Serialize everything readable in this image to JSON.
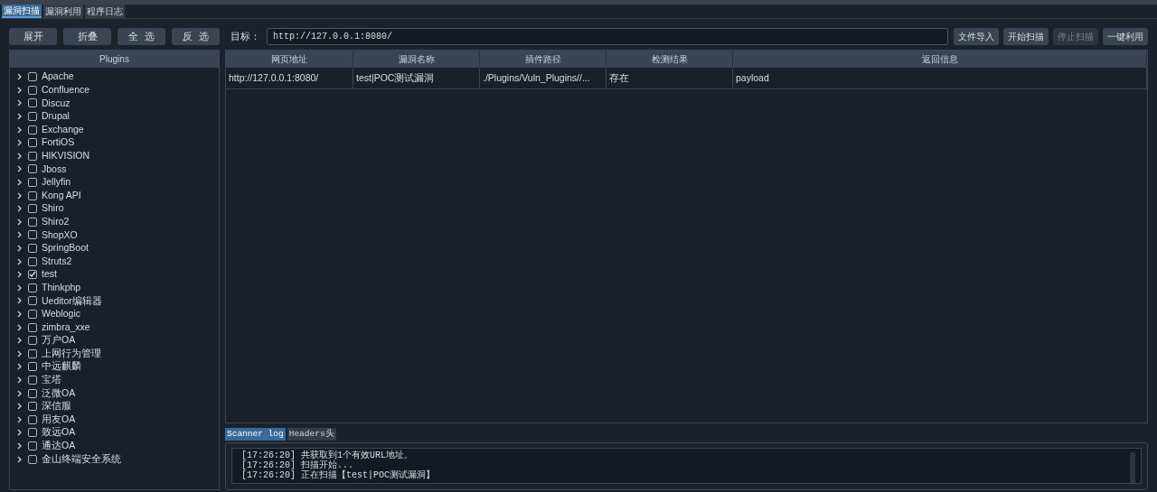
{
  "tabs": [
    {
      "label": "漏洞扫描",
      "selected": true
    },
    {
      "label": "漏洞利用",
      "selected": false
    },
    {
      "label": "程序日志",
      "selected": false
    }
  ],
  "tree_buttons": [
    "展开",
    "折叠",
    "全  选",
    "反  选"
  ],
  "target": {
    "label": "目标：",
    "value": "http://127.0.0.1:8080/"
  },
  "action_buttons": [
    {
      "label": "文件导入",
      "disabled": false
    },
    {
      "label": "开始扫描",
      "disabled": false
    },
    {
      "label": "停止扫描",
      "disabled": true
    },
    {
      "label": "一键利用",
      "disabled": false
    }
  ],
  "plugins": {
    "header": "Plugins",
    "items": [
      {
        "label": "Apache",
        "checked": false
      },
      {
        "label": "Confluence",
        "checked": false
      },
      {
        "label": "Discuz",
        "checked": false
      },
      {
        "label": "Drupal",
        "checked": false
      },
      {
        "label": "Exchange",
        "checked": false
      },
      {
        "label": "FortiOS",
        "checked": false
      },
      {
        "label": "HIKVISION",
        "checked": false
      },
      {
        "label": "Jboss",
        "checked": false
      },
      {
        "label": "Jellyfin",
        "checked": false
      },
      {
        "label": "Kong API",
        "checked": false
      },
      {
        "label": "Shiro",
        "checked": false
      },
      {
        "label": "Shiro2",
        "checked": false
      },
      {
        "label": "ShopXO",
        "checked": false
      },
      {
        "label": "SpringBoot",
        "checked": false
      },
      {
        "label": "Struts2",
        "checked": false
      },
      {
        "label": "test",
        "checked": true
      },
      {
        "label": "Thinkphp",
        "checked": false
      },
      {
        "label": "Ueditor编辑器",
        "checked": false
      },
      {
        "label": "Weblogic",
        "checked": false
      },
      {
        "label": "zimbra_xxe",
        "checked": false
      },
      {
        "label": "万户OA",
        "checked": false
      },
      {
        "label": "上网行为管理",
        "checked": false
      },
      {
        "label": "中远麒麟",
        "checked": false
      },
      {
        "label": "宝塔",
        "checked": false
      },
      {
        "label": "泛微OA",
        "checked": false
      },
      {
        "label": "深信服",
        "checked": false
      },
      {
        "label": "用友OA",
        "checked": false
      },
      {
        "label": "致远OA",
        "checked": false
      },
      {
        "label": "通达OA",
        "checked": false
      },
      {
        "label": "金山终端安全系统",
        "checked": false
      }
    ]
  },
  "table": {
    "columns": [
      "网页地址",
      "漏洞名称",
      "插件路径",
      "检测结果",
      "返回信息"
    ],
    "rows": [
      [
        "http://127.0.0.1:8080/",
        "test|POC测试漏洞",
        "./Plugins/Vuln_Plugins//...",
        "存在",
        "payload"
      ]
    ]
  },
  "log_tabs": [
    {
      "label": "Scanner log",
      "selected": true
    },
    {
      "label": "Headers头",
      "selected": false
    }
  ],
  "log": [
    "[17:26:20] 共获取到1个有效URL地址。",
    "[17:26:20] 扫描开始...",
    "[17:26:20] 正在扫描【test|POC测试漏洞】"
  ]
}
